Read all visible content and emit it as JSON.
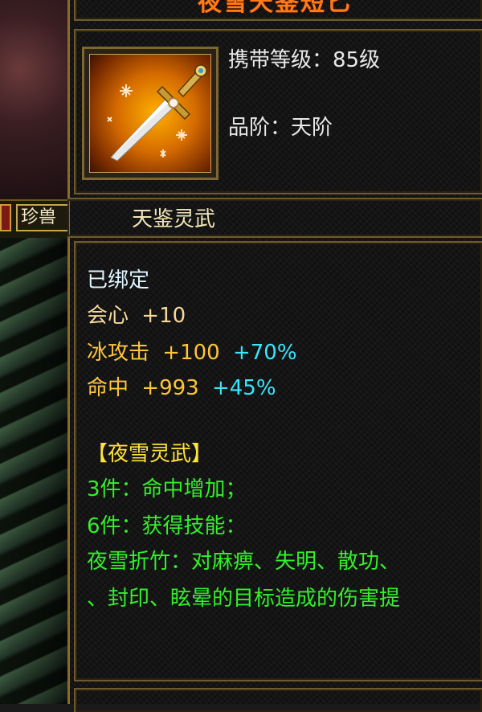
{
  "scene": {
    "tab_label": "珍兽"
  },
  "tooltip": {
    "item_name": "夜雪天鉴短匕",
    "level_line": "携带等级：85级",
    "grade_line": "品阶：天阶",
    "category": "天鉴灵武",
    "bound_status": "已绑定",
    "attributes": [
      {
        "name": "会心",
        "value": "+10",
        "bonus": ""
      },
      {
        "name": "冰攻击",
        "value": "+100",
        "bonus": "+70%"
      },
      {
        "name": "命中",
        "value": "+993",
        "bonus": "+45%"
      }
    ],
    "set": {
      "title": "【夜雪灵武】",
      "lines": [
        "3件：命中增加；",
        "6件：获得技能：",
        "夜雪折竹：对麻痹、失明、散功、",
        "、封印、眩晕的目标造成的伤害提"
      ]
    }
  },
  "colors": {
    "title": "#ff7a1a",
    "set_title": "#ffe23a",
    "set_text": "#32f02a",
    "bonus": "#38e6ff"
  },
  "icons": {
    "item_icon": "dagger-icon"
  }
}
